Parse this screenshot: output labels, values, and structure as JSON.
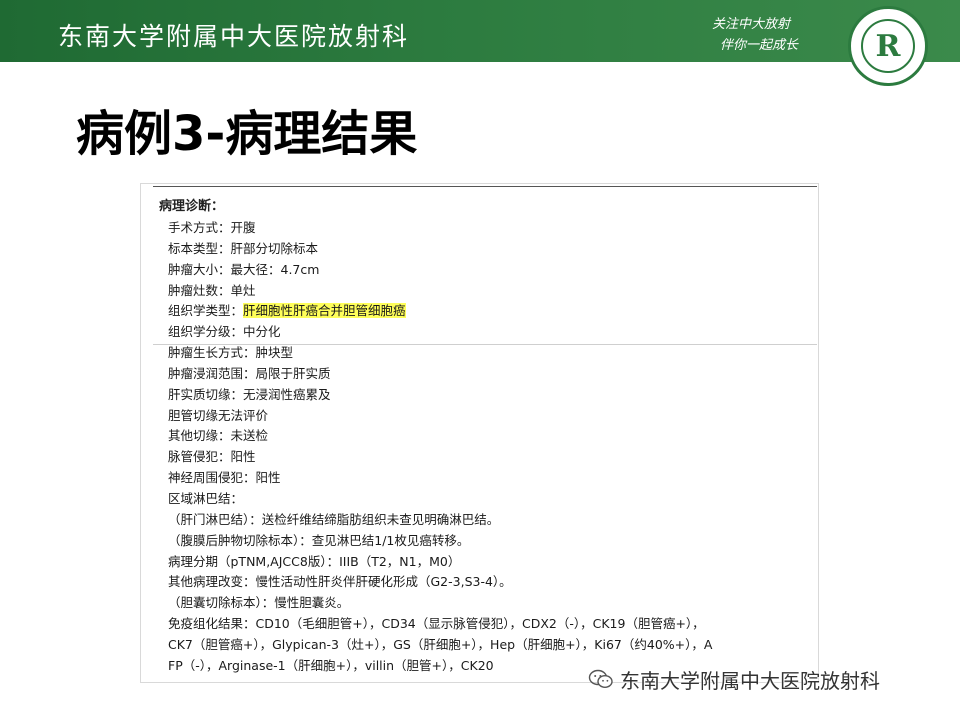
{
  "header": {
    "org_name": "东南大学附属中大医院放射科",
    "slogan_line1": "关注中大放射",
    "slogan_line2": "伴你一起成长",
    "logo_glyph": "R"
  },
  "slide": {
    "title": "病例3-病理结果"
  },
  "report": {
    "heading": "病理诊断：",
    "lines": [
      {
        "pre": "手术方式：开腹"
      },
      {
        "pre": "标本类型：肝部分切除标本"
      },
      {
        "pre": "肿瘤大小：最大径：4.7cm"
      },
      {
        "pre": "肿瘤灶数：单灶"
      },
      {
        "pre": "组织学类型：",
        "hl": "肝细胞性肝癌合并胆管细胞癌"
      },
      {
        "pre": "组织学分级：中分化"
      },
      {
        "pre": "肿瘤生长方式：肿块型"
      },
      {
        "pre": "肿瘤浸润范围：局限于肝实质"
      },
      {
        "pre": "肝实质切缘：无浸润性癌累及"
      },
      {
        "pre": "胆管切缘无法评价"
      },
      {
        "pre": "其他切缘：未送检"
      },
      {
        "pre": "脉管侵犯：阳性"
      },
      {
        "pre": "神经周围侵犯：阳性"
      },
      {
        "pre": "区域淋巴结："
      },
      {
        "pre": "（肝门淋巴结）：送检纤维结缔脂肪组织未查见明确淋巴结。"
      },
      {
        "pre": "（腹膜后肿物切除标本）：查见淋巴结1/1枚见癌转移。"
      },
      {
        "pre": "病理分期（pTNM,AJCC8版）：IIIB（T2，N1，M0）"
      },
      {
        "pre": "其他病理改变：慢性活动性肝炎伴肝硬化形成（G2-3,S3-4）。"
      },
      {
        "pre": "（胆囊切除标本）：慢性胆囊炎。"
      },
      {
        "pre": "免疫组化结果：CD10（毛细胆管+），CD34（显示脉管侵犯），CDX2（-），CK19（胆管癌+），"
      },
      {
        "pre": "CK7（胆管癌+），Glypican-3（灶+），GS（肝细胞+），Hep（肝细胞+），Ki67（约40%+），A"
      },
      {
        "pre": "FP（-），Arginase-1（肝细胞+），villin（胆管+），CK20"
      }
    ]
  },
  "watermark": {
    "icon": "wechat-icon",
    "text": "东南大学附属中大医院放射科"
  },
  "colors": {
    "header_green": "#2c7b3f",
    "highlight": "#ffff5a"
  }
}
